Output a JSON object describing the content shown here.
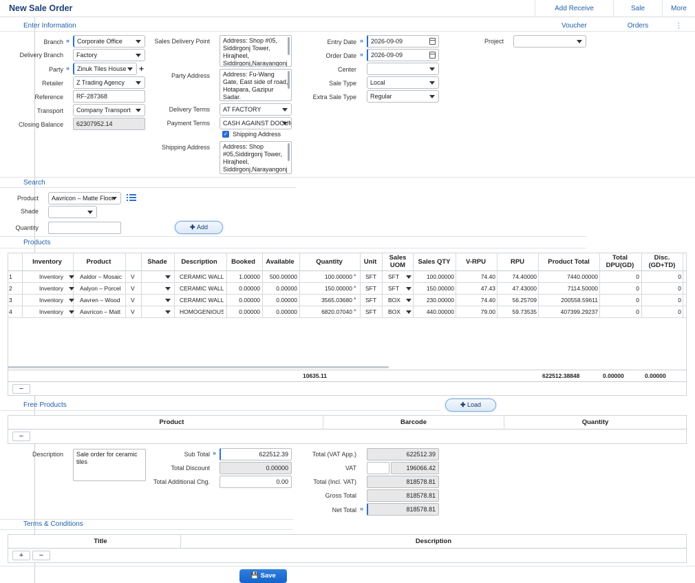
{
  "header": {
    "title": "New Sale Order",
    "nav": [
      "Add Receive Voucher",
      "Sale Orders",
      "More ⋮"
    ]
  },
  "sections": {
    "enter": "Enter Information",
    "search": "Search",
    "products": "Products",
    "free": "Free Products",
    "terms": "Terms & Conditions"
  },
  "form": {
    "branch_label": "Branch",
    "branch": "Corporate Office",
    "delivery_branch_label": "Delivery Branch",
    "delivery_branch": "Factory",
    "party_label": "Party",
    "party": "Zinuk Tiles House",
    "retailer_label": "Retailer",
    "retailer": "Z Trading Agency",
    "reference_label": "Reference",
    "reference": "RF-287368",
    "transport_label": "Transport",
    "transport": "Company Transport",
    "closing_balance_label": "Closing Balance",
    "closing_balance": "62307952.14",
    "sales_delivery_point_label": "Sales Delivery Point",
    "sales_delivery_point": "Address: Shop #05, Siddirgonj Tower, Hirajheel, Siddirgonj,Narayangonj",
    "party_address_label": "Party Address",
    "party_address": "Address: Fu-Wang Gate, East side of road, Hotapara, Gazipur Sadar.",
    "delivery_terms_label": "Delivery Terms",
    "delivery_terms": "AT FACTORY",
    "payment_terms_label": "Payment Terms",
    "payment_terms": "CASH AGAINST DOCUMENT",
    "shipping_checkbox_label": "Shipping Address",
    "shipping_address_label": "Shipping Address",
    "shipping_address": "Address: Shop #05,Siddirgonj Tower, Hirajheel, Siddirgonj,Narayangonj",
    "entry_date_label": "Entry Date",
    "entry_date": "2026-09-09",
    "order_date_label": "Order Date",
    "order_date": "2026-09-09",
    "center_label": "Center",
    "center": "",
    "sale_type_label": "Sale Type",
    "sale_type": "Local",
    "extra_sale_type_label": "Extra Sale Type",
    "extra_sale_type": "Regular",
    "project_label": "Project",
    "project": ""
  },
  "search": {
    "product_label": "Product",
    "product": "Aavricon – Matte Floor",
    "shade_label": "Shade",
    "shade": "",
    "quantity_label": "Quantity",
    "quantity": "",
    "add_label": "Add"
  },
  "products": {
    "columns": [
      "Inventory",
      "Product",
      "Shade",
      "Description",
      "Booked",
      "Available",
      "Quantity",
      "Unit",
      "Sales UOM",
      "Sales QTY",
      "V-RPU",
      "RPU",
      "Product Total",
      "Total DPU(GD)",
      "Disc. (GD+TD)"
    ],
    "rows": [
      {
        "n": "1",
        "inventory": "Inventory",
        "product": "Aaldor – Mosaic",
        "v": "V",
        "desc": "CERAMIC WALL",
        "booked": "1.00000",
        "available": "500.00000",
        "qty": "100.00000",
        "unit": "SFT",
        "uom": "SFT",
        "sqty": "100.00000",
        "vrpu": "74.40",
        "rpu": "74.40000",
        "total": "7440.00000",
        "dpu": "0",
        "disc": "0"
      },
      {
        "n": "2",
        "inventory": "Inventory",
        "product": "Aalyon – Porcel",
        "v": "V",
        "desc": "CERAMIC WALL",
        "booked": "0.00000",
        "available": "0.00000",
        "qty": "150.00000",
        "unit": "SFT",
        "uom": "SFT",
        "sqty": "150.00000",
        "vrpu": "47.43",
        "rpu": "47.43000",
        "total": "7114.50000",
        "dpu": "0",
        "disc": "0"
      },
      {
        "n": "3",
        "inventory": "Inventory",
        "product": "Aavren – Wood",
        "v": "V",
        "desc": "CERAMIC WALL",
        "booked": "0.00000",
        "available": "0.00000",
        "qty": "3565.03680",
        "unit": "SFT",
        "uom": "BOX",
        "sqty": "230.00000",
        "vrpu": "74.40",
        "rpu": "56.25709",
        "total": "200558.59611",
        "dpu": "0",
        "disc": "0"
      },
      {
        "n": "4",
        "inventory": "Inventory",
        "product": "Aavricon – Matt",
        "v": "V",
        "desc": "HOMOGENIOUS",
        "booked": "0.00000",
        "available": "0.00000",
        "qty": "6820.07040",
        "unit": "SFT",
        "uom": "BOX",
        "sqty": "440.00000",
        "vrpu": "79.00",
        "rpu": "59.73535",
        "total": "407399.29237",
        "dpu": "0",
        "disc": "0"
      }
    ],
    "footer": {
      "qty": "10635.11",
      "total": "622512.38848",
      "dpu": "0.00000",
      "disc": "0.00000"
    },
    "remove_label": "−"
  },
  "free": {
    "load_label": "Load",
    "columns": [
      "Product",
      "Barcode",
      "Quantity"
    ],
    "remove_label": "−"
  },
  "summary": {
    "description_label": "Description",
    "description": "Sale order for ceramic tiles",
    "subtotal_label": "Sub Total",
    "subtotal": "622512.39",
    "discount_label": "Total Discount",
    "discount": "0.00000",
    "addl_label": "Total Additional Chg.",
    "addl": "0.00",
    "vat_app_label": "Total (VAT App.)",
    "vat_app": "622512.39",
    "vat_label": "VAT",
    "vat": "196066.42",
    "incl_vat_label": "Total (Incl. VAT)",
    "incl_vat": "818578.81",
    "gross_label": "Gross Total",
    "gross": "818578.81",
    "net_label": "Net Total",
    "net": "818578.81"
  },
  "terms": {
    "columns": [
      "Title",
      "Description"
    ],
    "add_label": "+",
    "remove_label": "−"
  },
  "save_label": "Save",
  "colors": {
    "accent": "#1f5fa9",
    "title": "#1b3f73",
    "save": "#1564c9"
  }
}
